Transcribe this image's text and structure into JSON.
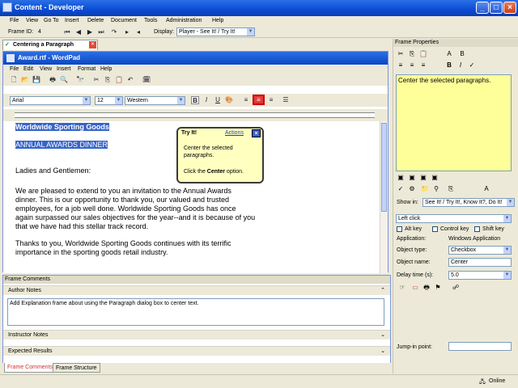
{
  "window": {
    "title": "Content - Developer"
  },
  "menu": [
    "File",
    "View",
    "Go To",
    "Insert",
    "Delete",
    "Document",
    "Tools",
    "Administration",
    "Help"
  ],
  "toolbar": {
    "frame_id_label": "Frame ID:",
    "frame_id_value": "4",
    "display_label": "Display:",
    "display_value": "Player - See It! / Try It!"
  },
  "tab": {
    "label": "Centering a Paragraph"
  },
  "wordpad": {
    "title": "Award.rtf - WordPad",
    "menu": [
      "File",
      "Edit",
      "View",
      "Insert",
      "Format",
      "Help"
    ],
    "font": "Arial",
    "size": "12",
    "script": "Western",
    "bold": "B",
    "italic": "I",
    "underline": "U",
    "doc": {
      "line1": "Worldwide Sporting Goods",
      "line2": "ANNUAL AWARDS DINNER",
      "line3": "Ladies and Gentlemen:",
      "p1a": "We are pleased to extend to you an invitation to the Annual Awards",
      "p1b": "dinner.  This is our opportunity to thank you, our valued and trusted",
      "p1c": "employees, for a job well done.  Worldwide Sporting Goods has once",
      "p1d": "again surpassed our sales objectives for the year--and it is because of you",
      "p1e": "that we have had this stellar track record.",
      "p2a": "Thanks to you, Worldwide Sporting Goods continues with its terrific",
      "p2b": "importance in the sporting goods retail industry."
    }
  },
  "tooltip": {
    "title": "Try It!",
    "actions": "Actions",
    "line1": "Center the selected",
    "line2": "paragraphs.",
    "line3_pre": "Click the ",
    "line3_bold": "Center",
    "line3_post": " option."
  },
  "comments": {
    "header": "Frame Comments",
    "author_notes": "Author Notes",
    "author_text": "Add Explanation frame about using the Paragraph dialog box to center text.",
    "instructor_notes": "Instructor Notes",
    "expected_results": "Expected Results",
    "tab1": "Frame Comments",
    "tab2": "Frame Structure"
  },
  "properties": {
    "header": "Frame Properties",
    "text": "Center the selected paragraphs.",
    "show_in_label": "Show in:",
    "show_in_value": "See It! / Try It!, Know It?, Do It!",
    "action": "Left click",
    "alt_key": "Alt key",
    "control_key": "Control key",
    "shift_key": "Shift key",
    "application_label": "Application:",
    "application_value": "Windows Application",
    "object_type_label": "Object type:",
    "object_type_value": "Checkbox",
    "object_name_label": "Object name:",
    "object_name_value": "Center",
    "delay_label": "Delay time (s):",
    "delay_value": "5.0",
    "jump_label": "Jump-in point:"
  },
  "status": {
    "online": "Online"
  }
}
